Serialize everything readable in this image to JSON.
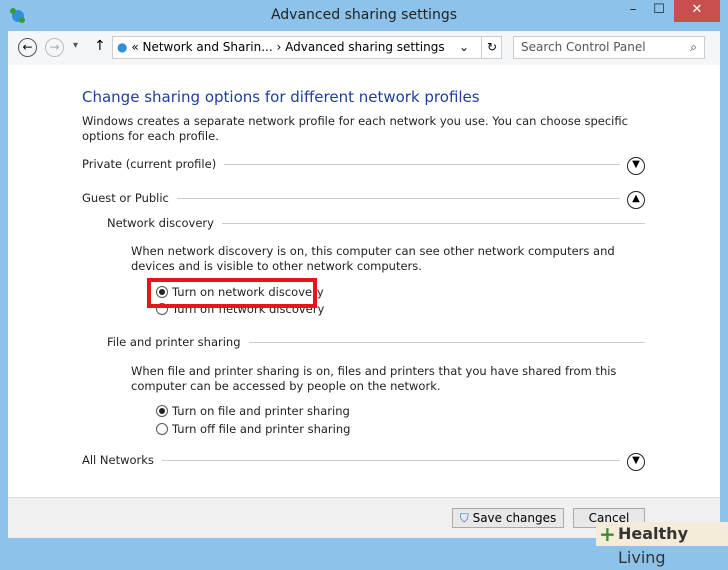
{
  "window": {
    "title": "Advanced sharing settings",
    "minimize": "–",
    "maximize": "☐",
    "close": "✕"
  },
  "nav": {
    "back": "←",
    "forward": "→",
    "recent": "▾",
    "up": "↑",
    "breadcrumb": [
      "Network and Sharin...",
      "Advanced sharing settings"
    ],
    "breadcrumb_prefix": "«",
    "separator": "›",
    "dropdown": "⌄",
    "refresh": "↻",
    "search_placeholder": "Search Control Panel",
    "search_icon": "⌕"
  },
  "main": {
    "heading": "Change sharing options for different network profiles",
    "intro": "Windows creates a separate network profile for each network you use. You can choose specific options for each profile.",
    "profiles": {
      "private": {
        "label": "Private (current profile)",
        "state": "collapsed"
      },
      "guest": {
        "label": "Guest or Public",
        "state": "expanded"
      },
      "all": {
        "label": "All Networks",
        "state": "collapsed"
      }
    },
    "discovery": {
      "title": "Network discovery",
      "desc": "When network discovery is on, this computer can see other network computers and devices and is visible to other network computers.",
      "on": "Turn on network discovery",
      "off": "Turn off network discovery",
      "selected": "on"
    },
    "sharing": {
      "title": "File and printer sharing",
      "desc": "When file and printer sharing is on, files and printers that you have shared from this computer can be accessed by people on the network.",
      "on": "Turn on file and printer sharing",
      "off": "Turn off file and printer sharing",
      "selected": "on"
    }
  },
  "footer": {
    "save": "Save changes",
    "cancel": "Cancel"
  },
  "watermark": {
    "brand": "Healthy",
    "rest": " Living"
  },
  "colors": {
    "frame": "#8dc3ea",
    "heading": "#1e3f9a",
    "highlight": "#e8141c",
    "close": "#c7504f"
  }
}
